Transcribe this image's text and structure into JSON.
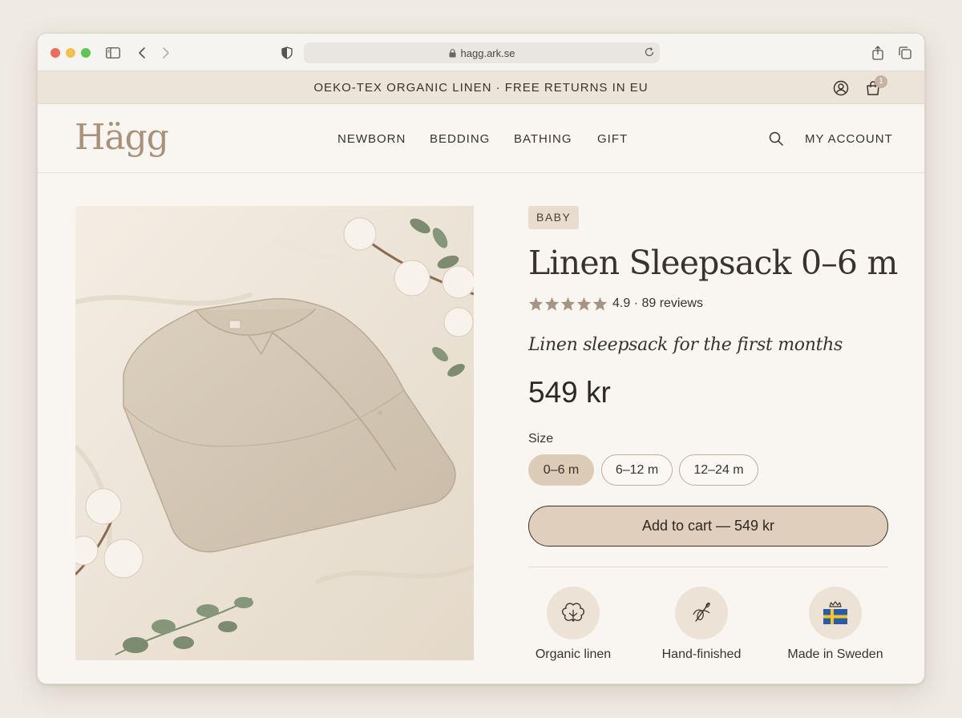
{
  "browser": {
    "url": "hagg.ark.se"
  },
  "announcement": {
    "text": "OEKO-TEX ORGANIC LINEN · FREE RETURNS IN EU",
    "cart_count": "1"
  },
  "header": {
    "logo": "Hägg",
    "nav": [
      "NEWBORN",
      "BEDDING",
      "BATHING",
      "GIFT"
    ],
    "account_label": "MY ACCOUNT"
  },
  "product": {
    "badge": "BABY",
    "title": "Linen Sleepsack 0–6 m",
    "rating": {
      "stars": 5,
      "text": "4.9 · 89 reviews"
    },
    "subtitle": "Linen sleepsack for the first months",
    "price": "549 kr",
    "size_label": "Size",
    "sizes": [
      "0–6 m",
      "6–12 m",
      "12–24 m"
    ],
    "selected_size": "0–6 m",
    "cart_button": "Add to cart — 549 kr",
    "features": [
      "Organic linen",
      "Hand-finished",
      "Made in Sweden"
    ]
  },
  "colors": {
    "accent": "#dfcfbc",
    "logo": "#a8927c",
    "text": "#3a322c",
    "star": "#a59482",
    "announcement_bg": "#ece4d8"
  },
  "icons": {
    "sidebar": "sidebar-icon",
    "back": "chevron-left-icon",
    "forward": "chevron-right-icon",
    "shield": "shield-icon",
    "lock": "lock-icon",
    "reload": "reload-icon",
    "share": "share-icon",
    "tabs": "tabs-icon",
    "user": "user-icon",
    "cart": "cart-icon",
    "search": "search-icon",
    "cotton": "cotton-icon",
    "needle": "needle-icon",
    "flag": "sweden-flag-icon"
  }
}
